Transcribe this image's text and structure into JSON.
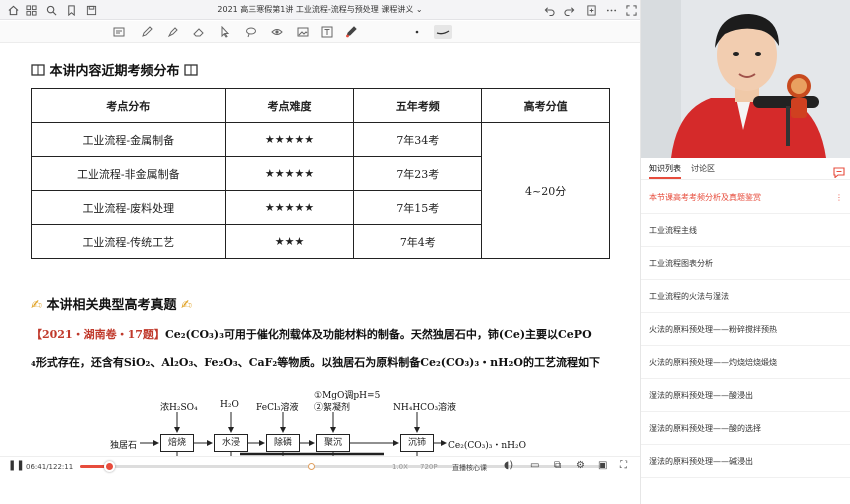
{
  "window": {
    "title": "2021 高三寒假第1讲 工业流程-流程与预处理 课程讲义",
    "title_suffix": "⌄"
  },
  "annotation_tools": [
    "text-frame",
    "pen",
    "highlighter",
    "eraser",
    "pointer",
    "lasso",
    "shapes",
    "eye",
    "image",
    "text",
    "pen-color",
    "dot",
    "line-style"
  ],
  "page": {
    "heading1": "本讲内容近期考频分布",
    "table": {
      "headers": [
        "考点分布",
        "考点难度",
        "五年考频",
        "高考分值"
      ],
      "rows": [
        {
          "topic": "工业流程-金属制备",
          "difficulty": "★★★★★",
          "frequency": "7年34考"
        },
        {
          "topic": "工业流程-非金属制备",
          "difficulty": "★★★★★",
          "frequency": "7年23考"
        },
        {
          "topic": "工业流程-废料处理",
          "difficulty": "★★★★★",
          "frequency": "7年15考"
        },
        {
          "topic": "工业流程-传统工艺",
          "difficulty": "★★★",
          "frequency": "7年4考"
        }
      ],
      "score": "4~20分"
    },
    "heading2": "本讲相关典型高考真题",
    "question": {
      "source": "【2021・湖南卷・17题】",
      "line1": "Ce₂(CO₃)₃可用于催化剂载体及功能材料的制备。天然独居石中，铈(Ce)主要以CePO",
      "line2": "₄形式存在，还含有SiO₂、Al₂O₃、Fe₂O₃、CaF₂等物质。以独居石为原料制备Ce₂(CO₃)₃・nH₂O的工艺流程如下"
    },
    "flowchart": {
      "start": "独居石",
      "steps": [
        "焙烧",
        "水浸",
        "除磷",
        "聚沉",
        "沉铈"
      ],
      "reagents": [
        "浓H₂SO₄",
        "H₂O",
        "FeCl₃溶液",
        "①MgO调pH=5",
        "②絮凝剂",
        "NH₄HCO₃溶液"
      ],
      "product": "Ce₂(CO₃)₃・nH₂O"
    }
  },
  "player": {
    "current_time": "06:41",
    "total_time": "122:11",
    "progress": 0.055,
    "speed": "1.0X",
    "quality": "720P",
    "label_core": "直播核心课"
  },
  "right_panel": {
    "tabs": [
      "知识列表",
      "讨论区"
    ],
    "items": [
      "本节课高考考频分析及真题鉴赏",
      "工业流程主线",
      "工业流程图表分析",
      "工业流程的火法与湿法",
      "火法的原料预处理——粉碎搅拌预热",
      "火法的原料预处理——灼烧焙烧煅烧",
      "湿法的原料预处理——酸浸出",
      "湿法的原料预处理——酸的选择",
      "湿法的原料预处理——碱浸出"
    ]
  },
  "colors": {
    "accent": "#e74c3c",
    "question_source": "#c0392b"
  }
}
